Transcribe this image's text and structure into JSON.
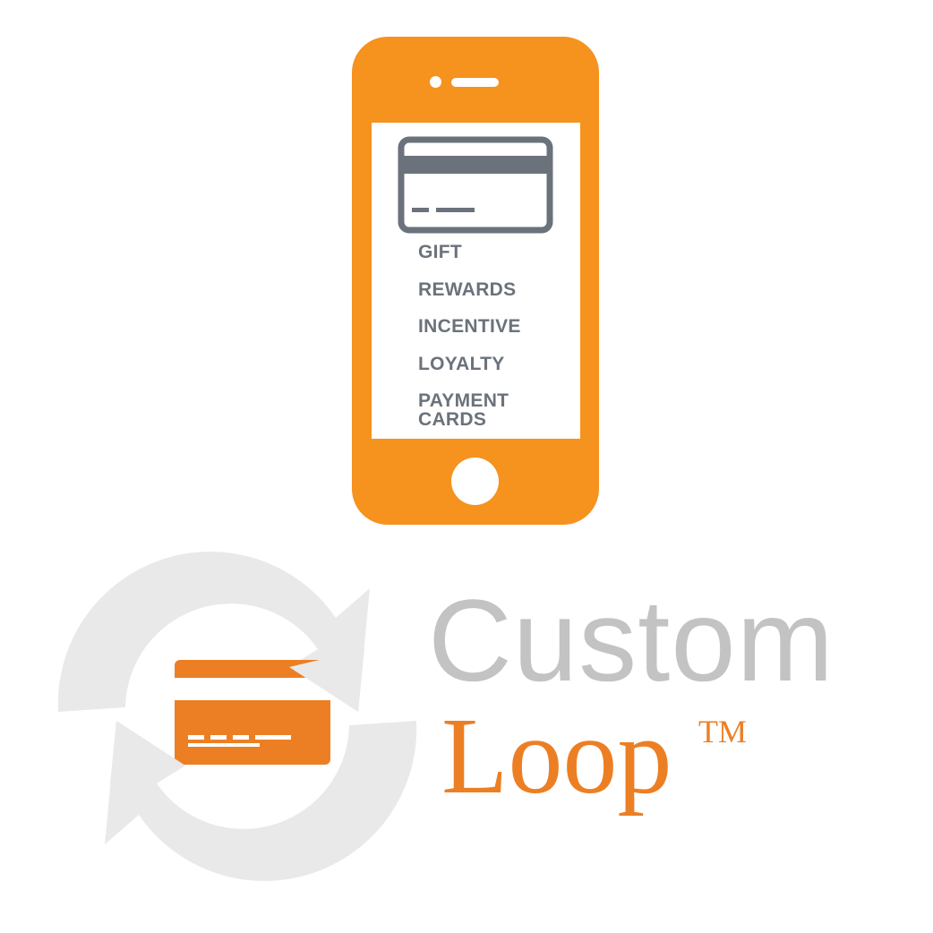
{
  "phone": {
    "card_types": [
      "GIFT",
      "REWARDS",
      "INCENTIVE",
      "LOYALTY",
      "PAYMENT\nCARDS"
    ]
  },
  "brand": {
    "line1": "Custom",
    "line2": "Loop",
    "trademark": "TM"
  },
  "colors": {
    "phone_orange": "#f6921e",
    "logo_orange": "#ec7f24",
    "icon_gray": "#6b727b",
    "loop_gray": "#e9e9e9",
    "wordmark_gray": "#c3c3c3",
    "background": "#ffffff"
  },
  "icons": [
    "smartphone-icon",
    "credit-card-icon",
    "refresh-loop-icon"
  ]
}
